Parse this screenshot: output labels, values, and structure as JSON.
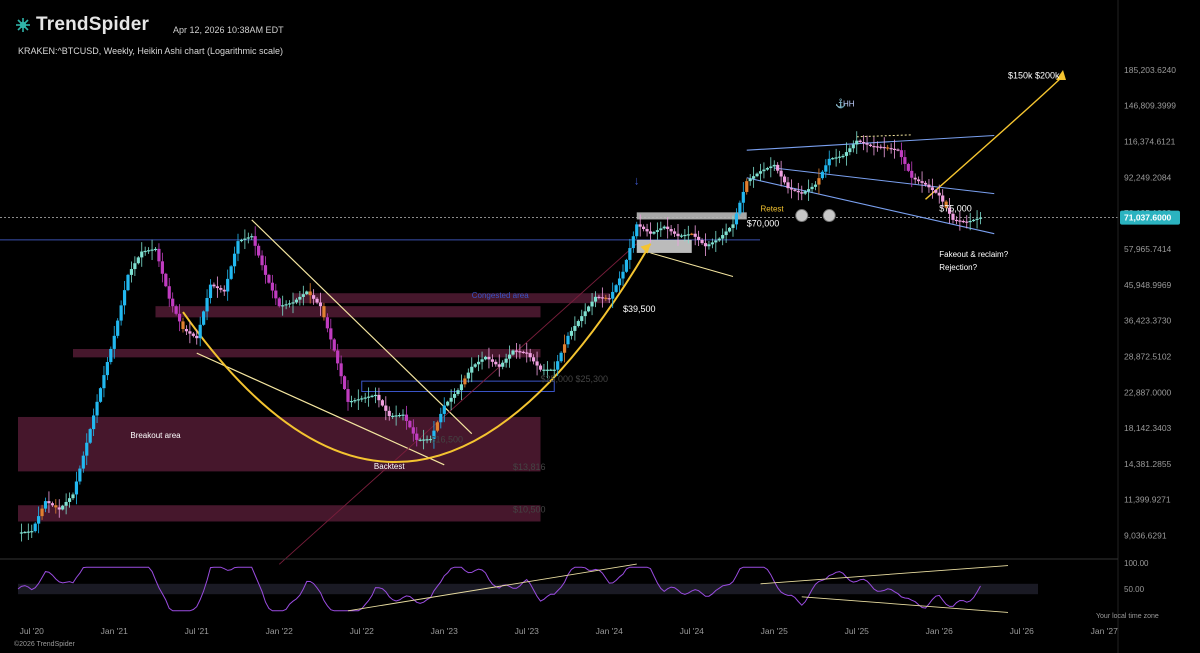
{
  "header": {
    "brand": "TrendSpider",
    "date": "Apr 12, 2026 10:38AM EDT",
    "symbol_line": "KRAKEN:^BTCUSD, Weekly, Heikin Ashi chart (Logarithmic scale)"
  },
  "footer": "©2026 TrendSpider",
  "chart_data": {
    "type": "candlestick",
    "symbol": "KRAKEN:^BTCUSD",
    "timeframe": "Weekly",
    "style": "Heikin Ashi",
    "scale": "log",
    "ylim": [
      8500,
      200000
    ],
    "y_ticks": [
      "185,203.6240",
      "146,809.3999",
      "116,374.6121",
      "92,249.2084",
      "73,125.1908",
      "57,965.7414",
      "45,948.9969",
      "36,423.3730",
      "28,872.5102",
      "22,887.0000",
      "18,142.3403",
      "14,381.2855",
      "11,399.9271",
      "9,036.6291"
    ],
    "y_tick_values": [
      185203.624,
      146809.3999,
      116374.6121,
      92249.2084,
      73125.1908,
      57965.7414,
      45948.9969,
      36423.373,
      28872.5102,
      22887.0,
      18142.3403,
      14381.2855,
      11399.9271,
      9036.6291
    ],
    "x_ticks": [
      "Jul '20",
      "Jan '21",
      "Jul '21",
      "Jan '22",
      "Jul '22",
      "Jan '23",
      "Jul '23",
      "Jan '24",
      "Jul '24",
      "Jan '25",
      "Jul '25",
      "Jan '26",
      "Jul '26",
      "Jan '27"
    ],
    "x_tick_dates": [
      "2020-07",
      "2021-01",
      "2021-07",
      "2022-01",
      "2022-07",
      "2023-01",
      "2023-07",
      "2024-01",
      "2024-07",
      "2025-01",
      "2025-07",
      "2026-01",
      "2026-07",
      "2027-01"
    ],
    "last_price": "71,037.6000",
    "last_price_value": 71037.6,
    "price_path": [
      [
        "2020-06",
        9200
      ],
      [
        "2020-07",
        9300
      ],
      [
        "2020-08",
        11300
      ],
      [
        "2020-09",
        10700
      ],
      [
        "2020-10",
        11800
      ],
      [
        "2020-11",
        16500
      ],
      [
        "2020-12",
        23500
      ],
      [
        "2021-01",
        33000
      ],
      [
        "2021-02",
        49000
      ],
      [
        "2021-03",
        57000
      ],
      [
        "2021-04",
        58000
      ],
      [
        "2021-05",
        42000
      ],
      [
        "2021-06",
        34500
      ],
      [
        "2021-07",
        32500
      ],
      [
        "2021-08",
        46000
      ],
      [
        "2021-09",
        44000
      ],
      [
        "2021-10",
        61000
      ],
      [
        "2021-11",
        63000
      ],
      [
        "2021-12",
        49000
      ],
      [
        "2022-01",
        40000
      ],
      [
        "2022-02",
        41000
      ],
      [
        "2022-03",
        44000
      ],
      [
        "2022-04",
        40000
      ],
      [
        "2022-05",
        30000
      ],
      [
        "2022-06",
        21500
      ],
      [
        "2022-07",
        22000
      ],
      [
        "2022-08",
        22500
      ],
      [
        "2022-09",
        19600
      ],
      [
        "2022-10",
        19800
      ],
      [
        "2022-11",
        16800
      ],
      [
        "2022-12",
        16900
      ],
      [
        "2023-01",
        21000
      ],
      [
        "2023-02",
        23200
      ],
      [
        "2023-03",
        27000
      ],
      [
        "2023-04",
        28800
      ],
      [
        "2023-05",
        27000
      ],
      [
        "2023-06",
        30000
      ],
      [
        "2023-07",
        29500
      ],
      [
        "2023-08",
        26500
      ],
      [
        "2023-09",
        26500
      ],
      [
        "2023-10",
        33000
      ],
      [
        "2023-11",
        37500
      ],
      [
        "2023-12",
        42500
      ],
      [
        "2024-01",
        42000
      ],
      [
        "2024-02",
        50000
      ],
      [
        "2024-03",
        68000
      ],
      [
        "2024-04",
        64000
      ],
      [
        "2024-05",
        67000
      ],
      [
        "2024-06",
        63000
      ],
      [
        "2024-07",
        64000
      ],
      [
        "2024-08",
        59000
      ],
      [
        "2024-09",
        62000
      ],
      [
        "2024-10",
        68000
      ],
      [
        "2024-11",
        90000
      ],
      [
        "2024-12",
        96000
      ],
      [
        "2025-01",
        100000
      ],
      [
        "2025-02",
        86000
      ],
      [
        "2025-03",
        83000
      ],
      [
        "2025-04",
        88000
      ],
      [
        "2025-05",
        104000
      ],
      [
        "2025-06",
        106000
      ],
      [
        "2025-07",
        117000
      ],
      [
        "2025-08",
        113000
      ],
      [
        "2025-09",
        112000
      ],
      [
        "2025-10",
        110000
      ],
      [
        "2025-11",
        92000
      ],
      [
        "2025-12",
        88000
      ],
      [
        "2026-01",
        82000
      ],
      [
        "2026-02",
        70000
      ],
      [
        "2026-03",
        69000
      ],
      [
        "2026-04",
        71037.6
      ]
    ],
    "annotations": [
      {
        "text": "$150k $200k"
      },
      {
        "text": "HH"
      },
      {
        "text": "Retest"
      },
      {
        "text": "$75,000"
      },
      {
        "text": "$70,000"
      },
      {
        "text": "Fakeout & reclaim?"
      },
      {
        "text": "Rejection?"
      },
      {
        "text": "Congested area"
      },
      {
        "text": "$39,500"
      },
      {
        "text": "$25,000 $25,300"
      },
      {
        "text": "$16,500"
      },
      {
        "text": "$13,816"
      },
      {
        "text": "$10,500"
      },
      {
        "text": "Breakout area"
      },
      {
        "text": "Backtest"
      }
    ],
    "oscillator": {
      "y_ticks": [
        "100.00",
        "50.00"
      ],
      "y_tick_values": [
        100,
        50
      ],
      "caption": "Your local time zone"
    }
  },
  "colors": {
    "background": "#000000",
    "bull": "#22b8f0",
    "bull_mid": "#7ee0d0",
    "bear": "#c03cc0",
    "bear_light": "#f0a0e0",
    "orange": "#e08030",
    "yellow": "#f4c430",
    "trend_blue": "#6f8fe8",
    "zone": "#5a1e38",
    "last_price_bg": "#2bb3c0",
    "oscillator": "#9a4ce0"
  }
}
